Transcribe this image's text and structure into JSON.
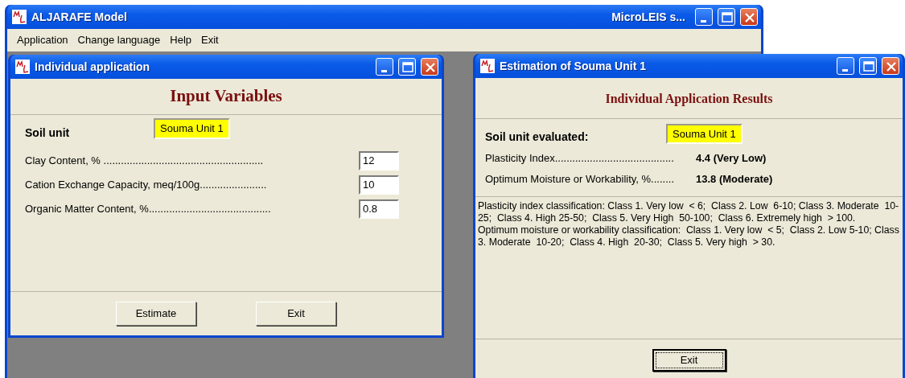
{
  "main_window": {
    "title": "ALJARAFE Model",
    "title_right": "MicroLEIS s..."
  },
  "menu": [
    "Application",
    "Change language",
    "Help",
    "Exit"
  ],
  "input_window": {
    "title": "Individual application",
    "heading": "Input Variables",
    "soil_unit": {
      "label": "Soil unit",
      "value": "Souma Unit 1"
    },
    "fields": [
      {
        "label": "Clay Content, % .......................................................",
        "value": "12"
      },
      {
        "label": "Cation Exchange Capacity, meq/100g.......................",
        "value": "10"
      },
      {
        "label": "Organic Matter Content, %..........................................",
        "value": "0.8"
      }
    ],
    "buttons": [
      {
        "label": "Estimate",
        "focused": false
      },
      {
        "label": "Exit",
        "focused": false
      }
    ]
  },
  "results_window": {
    "title": "Estimation of Souma Unit 1",
    "heading": "Individual Application Results",
    "soil_unit": {
      "label": "Soil unit evaluated:",
      "value": "Souma Unit 1"
    },
    "results": [
      {
        "label": "Plasticity Index.........................................",
        "value": "4.4 (Very Low)"
      },
      {
        "label": "Optimum Moisture or Workability, %........",
        "value": "13.8 (Moderate)"
      }
    ],
    "notes": [
      "Plasticity index classification: Class 1. Very low  < 6;  Class 2. Low  6-10; Class 3. Moderate  10-25;  Class 4. High 25-50;  Class 5. Very High  50-100;  Class 6. Extremely high  > 100.",
      "Optimum moisture or workability classification:  Class 1. Very low  < 5;  Class 2. Low 5-10; Class 3. Moderate  10-20;  Class 4. High  20-30;  Class 5. Very high  > 30."
    ],
    "buttons": [
      {
        "label": "Exit",
        "focused": true
      }
    ]
  }
}
